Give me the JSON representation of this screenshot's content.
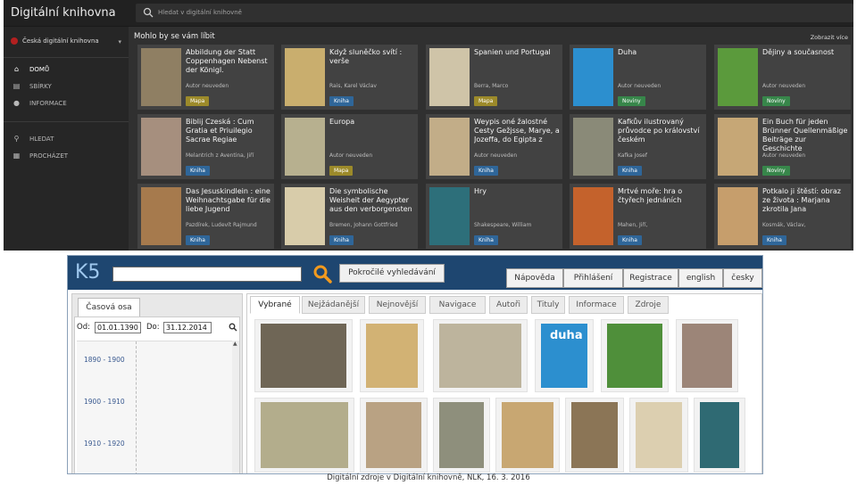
{
  "app": {
    "title": "Digitální knihovna",
    "search_placeholder": "Hledat v digitální knihovně",
    "library": "Česká digitální knihovna",
    "nav": [
      {
        "label": "DOMŮ",
        "icon": "home-icon",
        "active": true
      },
      {
        "label": "SBÍRKY",
        "icon": "collections-icon"
      },
      {
        "label": "INFORMACE",
        "icon": "info-icon"
      },
      {
        "label": "HLEDAT",
        "icon": "search-icon"
      },
      {
        "label": "PROCHÁZET",
        "icon": "browse-icon"
      }
    ],
    "section_title": "Mohlo by se vám líbit",
    "more_link": "Zobrazit více",
    "cards": [
      {
        "title": "Abbildung der Statt Coppenhagen Nebenst der Königl.",
        "author": "Autor neuveden",
        "badge": "Mapa",
        "kind": "mapa",
        "color": "#8f7f63"
      },
      {
        "title": "Když sluněčko svítí : verše",
        "author": "Rais, Karel Václav",
        "badge": "Kniha",
        "kind": "kniha",
        "color": "#c9ae6e"
      },
      {
        "title": "Spanien und Portugal",
        "author": "Berra, Marco",
        "badge": "Mapa",
        "kind": "mapa",
        "color": "#cfc4a8"
      },
      {
        "title": "Duha",
        "author": "Autor neuveden",
        "badge": "Noviny",
        "kind": "noviny",
        "color": "#2c8fcf"
      },
      {
        "title": "Dějiny a současnost",
        "author": "Autor neuveden",
        "badge": "Noviny",
        "kind": "noviny",
        "color": "#5b9a3c"
      },
      {
        "title": "Biblij Czeská : Cum Gratia et Priuilegio Sacrae Regiae",
        "author": "Melantrich z Aventina, Jiří",
        "badge": "Kniha",
        "kind": "kniha",
        "color": "#a68f7e"
      },
      {
        "title": "Europa",
        "author": "Autor neuveden",
        "badge": "Mapa",
        "kind": "mapa",
        "color": "#b7b08f"
      },
      {
        "title": "Weypis oné žalostné Cesty Gežjsse, Marye, a Jozeffa, do Egipta z",
        "author": "Autor neuveden",
        "badge": "Kniha",
        "kind": "kniha",
        "color": "#c2ad88"
      },
      {
        "title": "Kafkův ilustrovaný průvodce po království českém",
        "author": "Kafka Josef",
        "badge": "Kniha",
        "kind": "kniha",
        "color": "#8a8a78"
      },
      {
        "title": "Ein Buch für jeden Brünner Quellenmäßige Beiträge zur Geschichte",
        "author": "Autor neuveden",
        "badge": "Noviny",
        "kind": "noviny",
        "color": "#c6a776"
      },
      {
        "title": "Das Jesuskindlein : eine Weihnachtsgabe für die liebe Jugend",
        "author": "Pazdírek, Ludevít Rajmund",
        "badge": "Kniha",
        "kind": "kniha",
        "color": "#a67a4d"
      },
      {
        "title": "Die symbolische Weisheit der Aegypter aus den verborgensten",
        "author": "Bremen, Johann Gottfried",
        "badge": "Kniha",
        "kind": "kniha",
        "color": "#d8ccaa"
      },
      {
        "title": "Hry",
        "author": "Shakespeare, William",
        "badge": "Kniha",
        "kind": "kniha",
        "color": "#2d6f7a"
      },
      {
        "title": "Mrtvé moře: hra o čtyřech jednáních",
        "author": "Mahen, Jiří,",
        "badge": "Kniha",
        "kind": "kniha",
        "color": "#c4622c"
      },
      {
        "title": "Potkalo ji štěstí: obraz ze života : Marjana zkrotila Jana",
        "author": "Kosmák, Václav,",
        "badge": "Kniha",
        "kind": "kniha",
        "color": "#c69e6c"
      }
    ]
  },
  "k5": {
    "logo": "K5",
    "advanced_search": "Pokročilé vyhledávání",
    "top_buttons": [
      "Nápověda",
      "Přihlášení",
      "Registrace",
      "english",
      "česky"
    ],
    "timeline_tab": "Časová osa",
    "from_label": "Od:",
    "from_value": "01.01.1390",
    "to_label": "Do:",
    "to_value": "31.12.2014",
    "decades": [
      "1890 - 1900",
      "1900 - 1910",
      "1910 - 1920"
    ],
    "tabs": [
      "Vybrané",
      "Nejžádanější",
      "Nejnovější",
      "Navigace",
      "Autoři",
      "Tituly",
      "Informace",
      "Zdroje"
    ],
    "thumbs_row1": [
      {
        "color": "#6f6656",
        "label": ""
      },
      {
        "color": "#d2b274",
        "label": ""
      },
      {
        "color": "#bdb49d",
        "label": ""
      },
      {
        "color": "#2c8fcf",
        "label": "duha"
      },
      {
        "color": "#4f8f3a",
        "label": ""
      },
      {
        "color": "#9c8578",
        "label": ""
      }
    ],
    "thumbs_row2": [
      {
        "color": "#b3ad8c"
      },
      {
        "color": "#b9a283"
      },
      {
        "color": "#8e8f7c"
      },
      {
        "color": "#c8a772"
      },
      {
        "color": "#8b7556"
      },
      {
        "color": "#dccfb0"
      },
      {
        "color": "#2f6a73"
      }
    ]
  },
  "caption": "Digitální zdroje v Digitální knihovně, NLK, 16. 3. 2016"
}
